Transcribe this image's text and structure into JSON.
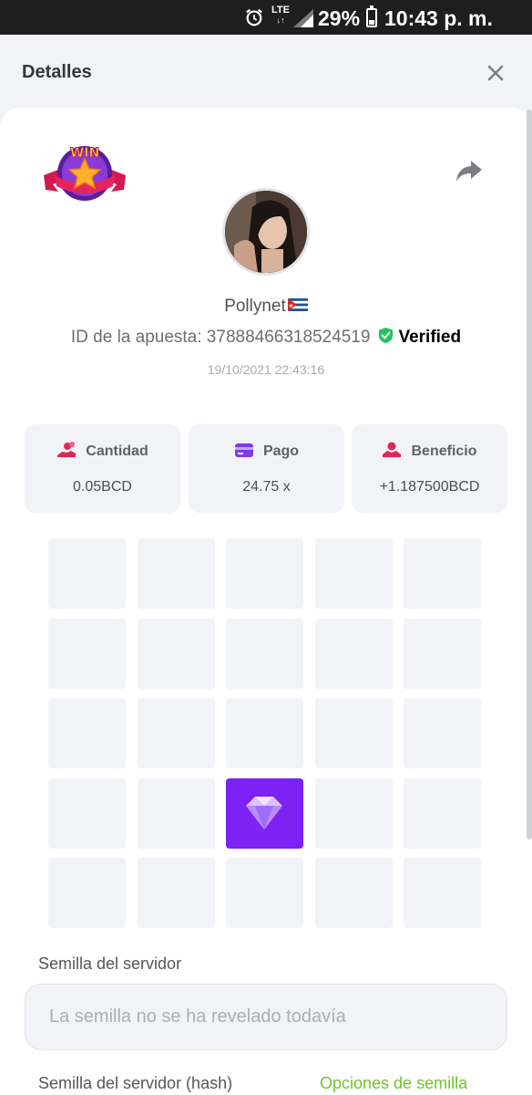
{
  "status_bar": {
    "network": "LTE",
    "battery_percent": "29%",
    "battery_level": 0.29,
    "time": "10:43 p. m."
  },
  "header": {
    "title": "Detalles"
  },
  "bet": {
    "username": "Pollynet",
    "bet_id_text": "ID de la apuesta: 3788846631852451​9",
    "verified_label": "Verified",
    "datetime": "19/10/2021 22:43:16",
    "badge_text": "WIN"
  },
  "stats": {
    "cantidad": {
      "label": "Cantidad",
      "value": "0.05BCD"
    },
    "pago": {
      "label": "Pago",
      "value": "24.75 x"
    },
    "beneficio": {
      "label": "Beneficio",
      "value": "+1.187500BCD"
    }
  },
  "board": {
    "rows": 5,
    "cols": 5,
    "revealed": [
      {
        "row": 4,
        "col": 3,
        "type": "gem"
      }
    ]
  },
  "seeds": {
    "server_seed_label": "Semilla del servidor",
    "server_seed_placeholder": "La semilla no se ha revelado todavía",
    "server_seed_hash_label": "Semilla del servidor (hash)",
    "seed_options_link": "Opciones de semilla"
  },
  "colors": {
    "gem_tile": "#7c22f5",
    "verified": "#22c55e",
    "link_green": "#6ec42a",
    "panel_bg": "#f2f3f7"
  }
}
